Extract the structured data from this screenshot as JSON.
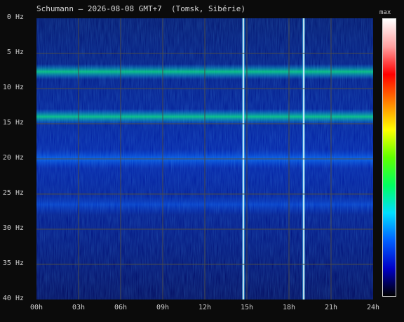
{
  "chart_data": {
    "type": "heatmap",
    "title": "Schumann – 2026-08-08 GMT+7  (Tomsk, Sibérie)",
    "ylabel": "",
    "xlabel": "",
    "y_ticks": [
      "0 Hz",
      "5 Hz",
      "10 Hz",
      "15 Hz",
      "20 Hz",
      "25 Hz",
      "30 Hz",
      "35 Hz",
      "40 Hz"
    ],
    "x_ticks": [
      "00h",
      "03h",
      "06h",
      "09h",
      "12h",
      "15h",
      "18h",
      "21h",
      "24h"
    ],
    "ylim": [
      0,
      40
    ],
    "xlim": [
      0,
      24
    ],
    "colorbar_label": "max",
    "colorbar_colors": [
      "#000000",
      "#0000c8",
      "#0060ff",
      "#00e0ff",
      "#00ff60",
      "#60ff00",
      "#ffff00",
      "#ff8000",
      "#ff0000",
      "#ffa0a0",
      "#ffffff"
    ],
    "grid": true,
    "bands": [
      {
        "freq_hz": 7.6,
        "label": "",
        "intensity": "high"
      },
      {
        "freq_hz": 14.0,
        "label": "",
        "intensity": "high"
      },
      {
        "freq_hz": 20.0,
        "label": "",
        "intensity": "medium"
      },
      {
        "freq_hz": 26.5,
        "label": "",
        "intensity": "low"
      }
    ],
    "impulse_events_hours": [
      14.75,
      19.05
    ]
  }
}
